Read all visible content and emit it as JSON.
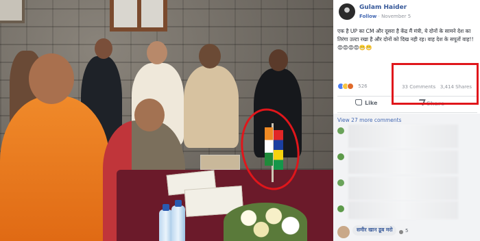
{
  "post": {
    "author": "Gulam Haider",
    "follow_label": "Follow",
    "date": "November 5",
    "text": "एक है UP का CM और दूसरा है केंद्र मैं मंत्री, ये दोनों के सामने देश का तिरंगा उल्टा रखा है और दोनों को दिख नही रह। वाह देश के सपूतों वाह!!😡😡😡😡😬😬",
    "reaction_count": "526",
    "comments_count": "33 Comments",
    "shares_count": "3,414 Shares"
  },
  "actions": {
    "like_label": "Like",
    "share_label": "Share"
  },
  "comments": {
    "view_more": "View 27 more comments",
    "visible_comment_author": "समीर खान डूब मरो",
    "visible_comment_reactions": "5"
  },
  "colors": {
    "fb_link": "#365899",
    "highlight": "#e0161b",
    "like_blue": "#4267b2"
  },
  "icons": [
    "avatar-icon",
    "like-reaction-icon",
    "haha-reaction-icon",
    "angry-reaction-icon",
    "like-thumb-icon",
    "share-arrow-icon"
  ]
}
